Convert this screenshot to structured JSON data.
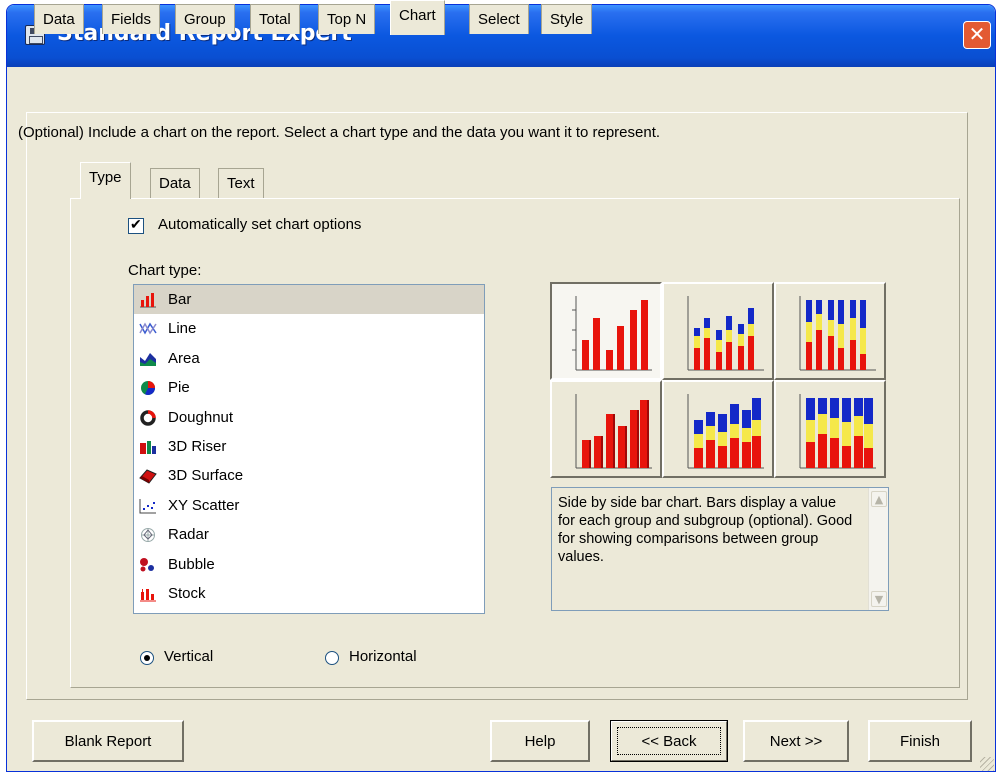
{
  "window": {
    "title": "Standard Report Expert"
  },
  "tabs": [
    {
      "label": "Data"
    },
    {
      "label": "Fields"
    },
    {
      "label": "Group"
    },
    {
      "label": "Total"
    },
    {
      "label": "Top N"
    },
    {
      "label": "Chart"
    },
    {
      "label": "Select"
    },
    {
      "label": "Style"
    }
  ],
  "active_tab": "Chart",
  "instructions": "(Optional) Include a chart on the report. Select a chart type and the data you want it to represent.",
  "inner_tabs": [
    {
      "label": "Type"
    },
    {
      "label": "Data"
    },
    {
      "label": "Text"
    }
  ],
  "active_inner_tab": "Type",
  "auto_checkbox": {
    "label": "Automatically set chart options",
    "checked": true
  },
  "chart_type_label": "Chart type:",
  "chart_types": [
    {
      "label": "Bar",
      "icon": "bar-chart-icon"
    },
    {
      "label": "Line",
      "icon": "line-chart-icon"
    },
    {
      "label": "Area",
      "icon": "area-chart-icon"
    },
    {
      "label": "Pie",
      "icon": "pie-chart-icon"
    },
    {
      "label": "Doughnut",
      "icon": "doughnut-chart-icon"
    },
    {
      "label": "3D Riser",
      "icon": "3d-riser-chart-icon"
    },
    {
      "label": "3D Surface",
      "icon": "3d-surface-chart-icon"
    },
    {
      "label": "XY Scatter",
      "icon": "xy-scatter-chart-icon"
    },
    {
      "label": "Radar",
      "icon": "radar-chart-icon"
    },
    {
      "label": "Bubble",
      "icon": "bubble-chart-icon"
    },
    {
      "label": "Stock",
      "icon": "stock-chart-icon"
    }
  ],
  "selected_chart_type": "Bar",
  "gallery": [
    {
      "name": "side-by-side-bar",
      "icon": "side-by-side-bar-icon",
      "selected": true
    },
    {
      "name": "stacked-bar",
      "icon": "stacked-bar-icon",
      "selected": false
    },
    {
      "name": "percent-bar",
      "icon": "percent-bar-icon",
      "selected": false
    },
    {
      "name": "3d-side-by-side-bar",
      "icon": "3d-side-by-side-bar-icon",
      "selected": false
    },
    {
      "name": "3d-stacked-bar",
      "icon": "3d-stacked-bar-icon",
      "selected": false
    },
    {
      "name": "3d-percent-bar",
      "icon": "3d-percent-bar-icon",
      "selected": false
    }
  ],
  "description": "Side by side bar chart. Bars display a value for each group and subgroup (optional). Good for showing comparisons between group values.",
  "orientation": {
    "vertical_label": "Vertical",
    "horizontal_label": "Horizontal",
    "selected": "Vertical"
  },
  "buttons": {
    "blank_report": "Blank Report",
    "help": "Help",
    "back": "<< Back",
    "next": "Next >>",
    "finish": "Finish"
  },
  "colors": {
    "titlebar": "#0a58e0",
    "dialog": "#ece9d8",
    "bar_red": "#e8140c",
    "bar_yellow": "#f5e84a",
    "bar_blue": "#1429c8",
    "close": "#e35a32"
  }
}
